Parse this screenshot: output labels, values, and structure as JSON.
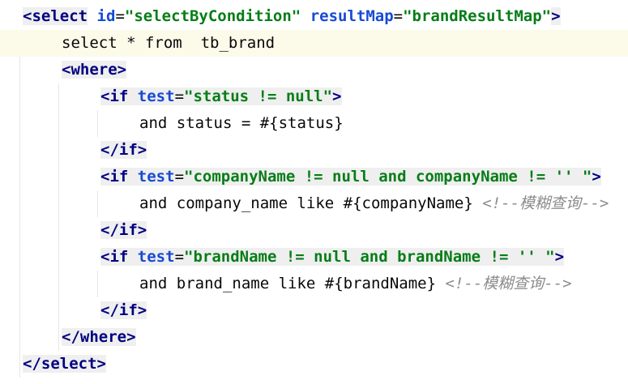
{
  "colors": {
    "background": "#ffffff",
    "current_line": "#fcfae9",
    "tag_highlight": "#efefef",
    "tag": "#000080",
    "attribute": "#174ad4",
    "string": "#067d17",
    "text": "#080808",
    "comment": "#8c8c8c"
  },
  "code_lines": [
    {
      "indent": 0,
      "tokens": [
        {
          "t": "<",
          "c": "tag",
          "h": true
        },
        {
          "t": "select",
          "c": "tag",
          "h": true
        },
        {
          "t": " ",
          "c": "plain"
        },
        {
          "t": "id",
          "c": "attr"
        },
        {
          "t": "=",
          "c": "plain"
        },
        {
          "t": "\"selectByCondition\"",
          "c": "str"
        },
        {
          "t": " ",
          "c": "plain"
        },
        {
          "t": "resultMap",
          "c": "attr"
        },
        {
          "t": "=",
          "c": "plain"
        },
        {
          "t": "\"brandResultMap\"",
          "c": "str"
        },
        {
          "t": ">",
          "c": "tag",
          "h": true
        }
      ]
    },
    {
      "indent": 1,
      "current": true,
      "tokens": [
        {
          "t": "select * from  tb_brand",
          "c": "plain"
        }
      ]
    },
    {
      "indent": 1,
      "tokens": [
        {
          "t": "<",
          "c": "tag",
          "h": true
        },
        {
          "t": "where",
          "c": "tag",
          "h": true
        },
        {
          "t": ">",
          "c": "tag",
          "h": true
        }
      ]
    },
    {
      "indent": 2,
      "tokens": [
        {
          "t": "<",
          "c": "tag",
          "h": true
        },
        {
          "t": "if",
          "c": "tag",
          "h": true
        },
        {
          "t": " ",
          "c": "plain",
          "h": true
        },
        {
          "t": "test",
          "c": "attr",
          "h": true
        },
        {
          "t": "=",
          "c": "plain",
          "h": true
        },
        {
          "t": "\"status != null\"",
          "c": "str",
          "h": true
        },
        {
          "t": ">",
          "c": "tag",
          "h": true
        }
      ]
    },
    {
      "indent": 3,
      "tokens": [
        {
          "t": "and status = #{status}",
          "c": "plain"
        }
      ]
    },
    {
      "indent": 2,
      "tokens": [
        {
          "t": "</",
          "c": "tag",
          "h": true
        },
        {
          "t": "if",
          "c": "tag",
          "h": true
        },
        {
          "t": ">",
          "c": "tag",
          "h": true
        }
      ]
    },
    {
      "indent": 2,
      "tokens": [
        {
          "t": "<",
          "c": "tag",
          "h": true
        },
        {
          "t": "if",
          "c": "tag",
          "h": true
        },
        {
          "t": " ",
          "c": "plain",
          "h": true
        },
        {
          "t": "test",
          "c": "attr",
          "h": true
        },
        {
          "t": "=",
          "c": "plain",
          "h": true
        },
        {
          "t": "\"companyName != null and companyName != '' \"",
          "c": "str",
          "h": true
        },
        {
          "t": ">",
          "c": "tag",
          "h": true
        }
      ]
    },
    {
      "indent": 3,
      "tokens": [
        {
          "t": "and company_name like #{companyName} ",
          "c": "plain"
        },
        {
          "t": "<!--模糊查询-->",
          "c": "comment"
        }
      ]
    },
    {
      "indent": 2,
      "tokens": [
        {
          "t": "</",
          "c": "tag",
          "h": true
        },
        {
          "t": "if",
          "c": "tag",
          "h": true
        },
        {
          "t": ">",
          "c": "tag",
          "h": true
        }
      ]
    },
    {
      "indent": 2,
      "tokens": [
        {
          "t": "<",
          "c": "tag",
          "h": true
        },
        {
          "t": "if",
          "c": "tag",
          "h": true
        },
        {
          "t": " ",
          "c": "plain",
          "h": true
        },
        {
          "t": "test",
          "c": "attr",
          "h": true
        },
        {
          "t": "=",
          "c": "plain",
          "h": true
        },
        {
          "t": "\"brandName != null and brandName != '' \"",
          "c": "str",
          "h": true
        },
        {
          "t": ">",
          "c": "tag",
          "h": true
        }
      ]
    },
    {
      "indent": 3,
      "tokens": [
        {
          "t": "and brand_name like #{brandName} ",
          "c": "plain"
        },
        {
          "t": "<!--模糊查询-->",
          "c": "comment"
        }
      ]
    },
    {
      "indent": 2,
      "tokens": [
        {
          "t": "</",
          "c": "tag",
          "h": true
        },
        {
          "t": "if",
          "c": "tag",
          "h": true
        },
        {
          "t": ">",
          "c": "tag",
          "h": true
        }
      ]
    },
    {
      "indent": 1,
      "tokens": [
        {
          "t": "</",
          "c": "tag",
          "h": true
        },
        {
          "t": "where",
          "c": "tag",
          "h": true
        },
        {
          "t": ">",
          "c": "tag",
          "h": true
        }
      ]
    },
    {
      "indent": 0,
      "tokens": [
        {
          "t": "</",
          "c": "tag",
          "h": true
        },
        {
          "t": "select",
          "c": "tag",
          "h": true
        },
        {
          "t": ">",
          "c": "tag",
          "h": true
        }
      ]
    }
  ]
}
